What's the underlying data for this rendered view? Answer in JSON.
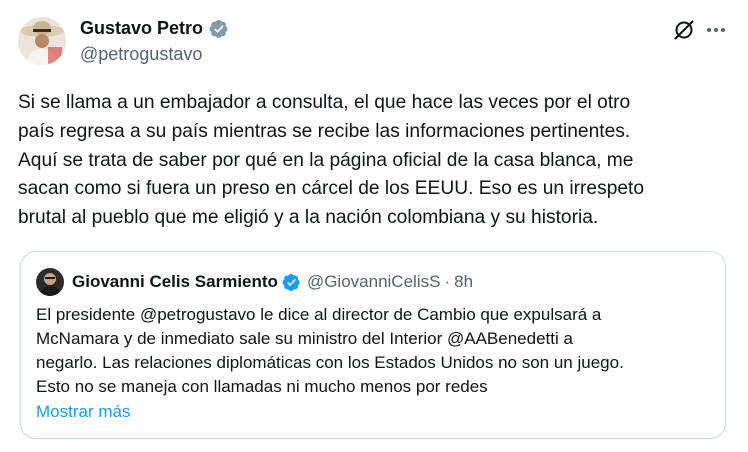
{
  "author": {
    "name": "Gustavo Petro",
    "handle": "@petrogustavo",
    "verified_color": "#829aab"
  },
  "icons": {
    "grok": "grok-icon",
    "more": "more-options-icon"
  },
  "tweet": {
    "lines": [
      "Si se llama a un embajador a consulta, el que hace las veces por el otro",
      "país regresa a su país mientras se recibe las informaciones pertinentes.",
      "Aquí se trata de saber por qué en la página oficial de la casa blanca, me",
      "sacan como si fuera un preso en cárcel de los EEUU. Eso es un irrespeto",
      "brutal al pueblo que me eligió y a la nación colombiana y su historia."
    ]
  },
  "quote": {
    "name": "Giovanni Celis Sarmiento",
    "handle": "@GiovanniCelisS",
    "separator": "·",
    "time": "8h",
    "verified_color": "#1d9bf0",
    "lines": [
      "El presidente @petrogustavo le dice al director de Cambio que expulsará a",
      "McNamara y de inmediato sale su ministro del Interior @AABenedetti a",
      "negarlo. Las relaciones diplomáticas con los Estados Unidos no son un juego.",
      "Esto no se maneja con llamadas ni mucho menos por redes"
    ],
    "show_more": "Mostrar más"
  },
  "colors": {
    "link": "#1d9bf0",
    "secondary_text": "#536471",
    "border": "#cfd9de"
  }
}
